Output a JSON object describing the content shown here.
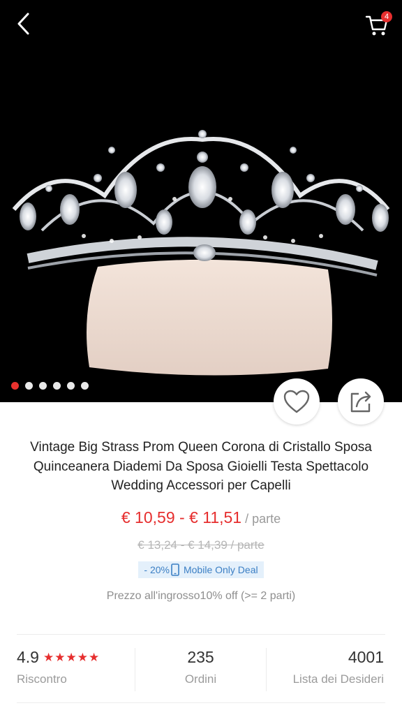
{
  "header": {
    "back_icon": "chevron-left-icon",
    "cart_icon": "cart-icon",
    "cart_count": "4"
  },
  "gallery": {
    "image_count": 6,
    "active_index": 0,
    "wishlist_icon": "heart-icon",
    "share_icon": "share-icon"
  },
  "product": {
    "title": "Vintage Big Strass Prom Queen Corona di Cristallo Sposa Quinceanera Diademi Da Sposa Gioielli Testa Spettacolo Wedding Accessori per Capelli",
    "price": "€ 10,59 - € 11,51",
    "price_unit": " / parte",
    "original_price": "€ 13,24 - € 14,39  / parte",
    "discount": "- 20%",
    "deal_label": "Mobile Only Deal",
    "wholesale": "Prezzo all'ingrosso10% off (>= 2 parti)"
  },
  "stats": {
    "rating": "4.9",
    "stars": "★★★★★",
    "rating_label": "Riscontro",
    "orders": "235",
    "orders_label": "Ordini",
    "wishlist": "4001",
    "wishlist_label": "Lista dei Desideri"
  },
  "colors": {
    "accent": "#e62e2e",
    "deal_bg": "#e4f0fb",
    "deal_text": "#3b7fc4"
  }
}
